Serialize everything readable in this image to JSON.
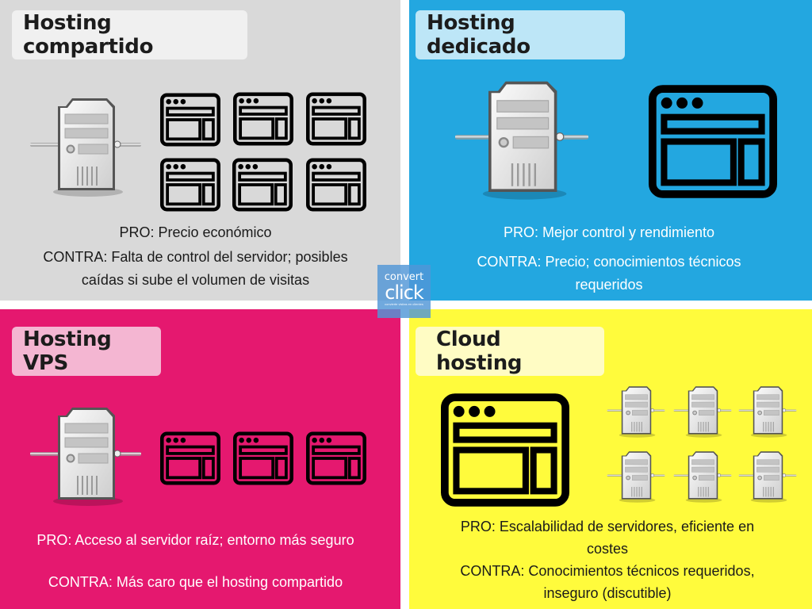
{
  "quadrants": {
    "shared": {
      "title": "Hosting compartido",
      "pro": "PRO: Precio económico",
      "contra_line1": "CONTRA: Falta de control del servidor; posibles",
      "contra_line2": "caídas si sube el volumen de visitas",
      "servers": 1,
      "websites": 6,
      "background": "#d9d9d9"
    },
    "dedicated": {
      "title": "Hosting dedicado",
      "pro": "PRO: Mejor control y rendimiento",
      "contra_line1": "CONTRA: Precio; conocimientos técnicos",
      "contra_line2": "requeridos",
      "servers": 1,
      "websites": 1,
      "background": "#23a7e0"
    },
    "vps": {
      "title": "Hosting VPS",
      "pro": "PRO: Acceso al servidor raíz; entorno más seguro",
      "contra": "CONTRA: Más caro que el hosting compartido",
      "servers": 1,
      "websites": 3,
      "background": "#e5186f"
    },
    "cloud": {
      "title": "Cloud hosting",
      "pro_line1": "PRO: Escalabilidad de servidores, eficiente en",
      "pro_line2": "costes",
      "contra_line1": "CONTRA: Conocimientos técnicos requeridos,",
      "contra_line2": "inseguro (discutible)",
      "servers": 6,
      "websites": 1,
      "background": "#fffb3c"
    }
  },
  "logo": {
    "line1": "convert",
    "line2": "click",
    "tagline": "convierte visitas en clientes"
  },
  "icons": {
    "server": "server-tower-icon",
    "website": "browser-window-icon"
  }
}
